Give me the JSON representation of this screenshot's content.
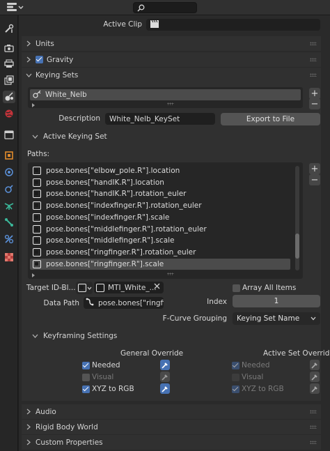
{
  "topbar": {
    "editor_icon": "properties-editor-icon",
    "search_icon": "search-icon"
  },
  "sidebar_tabs": [
    {
      "name": "tool-tab-icon",
      "active": false
    },
    {
      "name": "render-tab-icon",
      "active": false
    },
    {
      "name": "output-tab-icon",
      "active": false
    },
    {
      "name": "view-layer-tab-icon",
      "active": false
    },
    {
      "name": "scene-tab-icon",
      "active": true
    },
    {
      "name": "world-tab-icon",
      "active": false
    },
    {
      "name": "collection-tab-icon",
      "active": false
    },
    {
      "name": "object-tab-icon",
      "active": false
    },
    {
      "name": "modifiers-tab-icon",
      "active": false
    },
    {
      "name": "particles-tab-icon",
      "active": false
    },
    {
      "name": "physics-tab-icon",
      "active": false
    },
    {
      "name": "constraints-tab-icon",
      "active": false
    },
    {
      "name": "data-tab-icon",
      "active": false
    },
    {
      "name": "texture-tab-icon",
      "active": false
    }
  ],
  "active_clip": {
    "label": "Active Clip",
    "icon": "clip-icon"
  },
  "panels": {
    "units": "Units",
    "gravity": "Gravity",
    "keying_sets": "Keying Sets",
    "audio": "Audio",
    "rigid_body_world": "Rigid Body World",
    "custom_properties": "Custom Properties"
  },
  "gravity_checked": true,
  "keying_sets": {
    "items": [
      "White_Nelb"
    ],
    "description_label": "Description",
    "description_value": "White_Nelb_KeySet",
    "export_label": "Export to File"
  },
  "active_keying_set": {
    "title": "Active Keying Set",
    "paths_label": "Paths:",
    "paths": [
      "pose.bones[\"elbow_pole.R\"].location",
      "pose.bones[\"handIK.R\"].location",
      "pose.bones[\"handIK.R\"].rotation_euler",
      "pose.bones[\"indexfinger.R\"].rotation_euler",
      "pose.bones[\"indexfinger.R\"].scale",
      "pose.bones[\"middlefinger.R\"].rotation_euler",
      "pose.bones[\"middlefinger.R\"].scale",
      "pose.bones[\"ringfinger.R\"].rotation_euler",
      "pose.bones[\"ringfinger.R\"].scale"
    ],
    "selected_index": 8,
    "scroll_fraction": 0.85,
    "target_label": "Target ID-Bl...",
    "target_value": "MTI_White_...",
    "data_path_label": "Data Path",
    "data_path_value": "pose.bones[\"ringfin...",
    "array_all_items_label": "Array All Items",
    "array_all_items_checked": false,
    "index_label": "Index",
    "index_value": "1",
    "fcurve_grouping_label": "F-Curve Grouping",
    "fcurve_grouping_value": "Keying Set Name"
  },
  "keyframing": {
    "title": "Keyframing Settings",
    "general_header": "General Override",
    "active_header": "Active Set Override",
    "general": [
      {
        "label": "Needed",
        "checked": true,
        "eyedropper_active": true
      },
      {
        "label": "Visual",
        "checked": false,
        "eyedropper_active": false
      },
      {
        "label": "XYZ to RGB",
        "checked": true,
        "eyedropper_active": true
      }
    ],
    "active": [
      {
        "label": "Needed",
        "checked": true
      },
      {
        "label": "Visual",
        "checked": false
      },
      {
        "label": "XYZ to RGB",
        "checked": true
      }
    ]
  },
  "colors": {
    "accent": "#4772b3",
    "panel": "#303030",
    "field": "#1f1f1f",
    "button": "#545454"
  }
}
